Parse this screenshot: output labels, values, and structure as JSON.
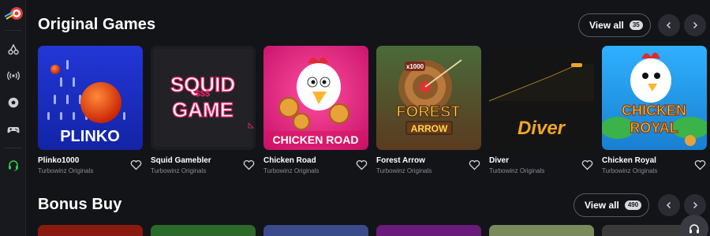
{
  "sections": {
    "original": {
      "title": "Original Games",
      "view_all_label": "View all",
      "count": "35"
    },
    "bonus": {
      "title": "Bonus Buy",
      "view_all_label": "View all",
      "count": "490"
    }
  },
  "games": [
    {
      "title": "Plinko1000",
      "provider": "Turbowinz Originals",
      "art_text": "PLINKO"
    },
    {
      "title": "Squid Gamebler",
      "provider": "Turbowinz Originals",
      "art_text_1": "SQUID",
      "art_text_2": "GAME"
    },
    {
      "title": "Chicken Road",
      "provider": "Turbowinz Originals",
      "art_text": "CHICKEN ROAD"
    },
    {
      "title": "Forest Arrow",
      "provider": "Turbowinz Originals",
      "art_text_1": "FOREST",
      "art_text_2": "ARROW",
      "art_badge": "x1000"
    },
    {
      "title": "Diver",
      "provider": "Turbowinz Originals",
      "art_text": "Diver"
    },
    {
      "title": "Chicken Royal",
      "provider": "Turbowinz Originals",
      "art_text_1": "CHICKEN",
      "art_text_2": "ROYAL"
    }
  ],
  "colors": {
    "background": "#131418",
    "sidebar": "#18191e",
    "accent_green": "#2ecc40",
    "muted_text": "#8a8b93"
  },
  "icons": [
    "logo-icon",
    "music-note-icon",
    "live-broadcast-icon",
    "soccer-ball-icon",
    "gamepad-icon",
    "headset-icon",
    "heart-icon",
    "chevron-left-icon",
    "chevron-right-icon",
    "support-headset-icon"
  ]
}
